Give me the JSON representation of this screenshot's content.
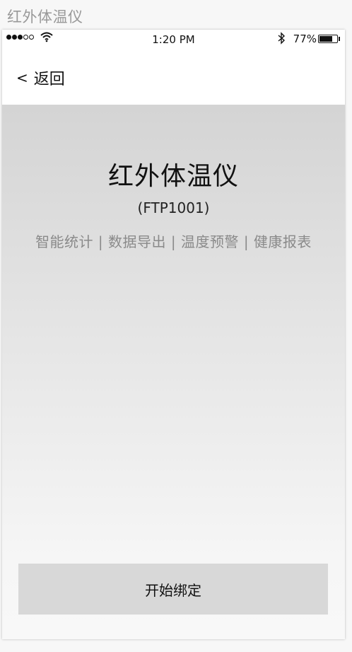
{
  "artboard": {
    "title": "红外体温仪"
  },
  "statusbar": {
    "time": "1:20 PM",
    "battery_percent": "77%",
    "battery_level": 0.77,
    "signal_bars_filled": 3,
    "signal_bars_total": 5,
    "icons": [
      "signal-dots-icon",
      "wifi-icon",
      "bluetooth-icon",
      "battery-icon"
    ]
  },
  "navbar": {
    "back_label": "返回",
    "back_chevron": "<"
  },
  "product": {
    "title": "红外体温仪",
    "model": "(FTP1001)",
    "features": "智能统计 | 数据导出 | 温度预警 | 健康报表"
  },
  "actions": {
    "bind_label": "开始绑定"
  }
}
